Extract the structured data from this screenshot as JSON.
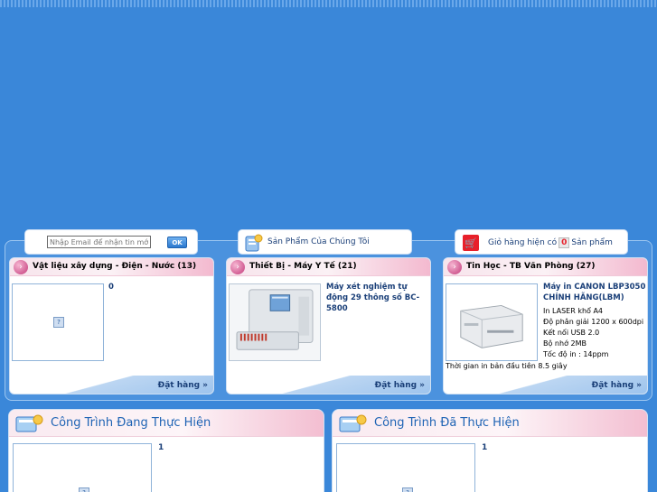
{
  "newsletter": {
    "placeholder": "Nhập Email để nhận tin mới",
    "ok_label": "OK"
  },
  "tabs": {
    "products_label": "Sản Phẩm Của Chúng Tôi",
    "cart_prefix": "Giỏ hàng hiện có",
    "cart_count": "0",
    "cart_suffix": "Sản phẩm"
  },
  "categories": [
    {
      "title": "Vật liệu xây dựng - Điện - Nước (13)",
      "product_name": "0",
      "order_label": "Đặt hàng »"
    },
    {
      "title": "Thiết Bị - Máy Y Tế (21)",
      "product_name": "Máy xét nghiệm tự động 29 thông số BC-5800",
      "order_label": "Đặt hàng »"
    },
    {
      "title": "Tin Học - TB Văn Phòng (27)",
      "product_name": "Máy in CANON LBP3050 CHÍNH HÃNG(LBM)",
      "specs": [
        "In LASER khổ A4",
        "Độ phân giải 1200 x 600dpi",
        "Kết nối USB 2.0",
        "Bộ nhớ 2MB",
        "Tốc độ in : 14ppm"
      ],
      "note": "Thời gian in bản đầu tiên 8.5 giây",
      "order_label": "Đặt hàng »"
    }
  ],
  "projects": {
    "ongoing_title": "Công Trình Đang Thực Hiện",
    "ongoing_item": "1",
    "done_title": "Công Trình Đã Thực Hiện",
    "done_item": "1"
  },
  "colors": {
    "background": "#3a87d9",
    "title_blue": "#1e63b4",
    "cart_red": "#e8202a"
  },
  "icons": [
    "ok-button",
    "products-icon",
    "cart-icon",
    "category-bullet-icon",
    "broken-image-icon",
    "project-icon"
  ]
}
